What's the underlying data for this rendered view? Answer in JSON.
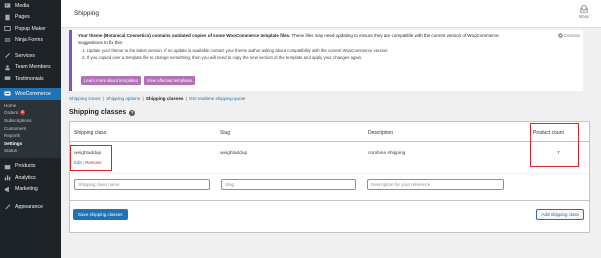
{
  "sidebar": {
    "items_top": [
      {
        "label": "Media",
        "icon": "media-icon"
      },
      {
        "label": "Pages",
        "icon": "pages-icon"
      },
      {
        "label": "Popup Maker",
        "icon": "popup-icon"
      },
      {
        "label": "Ninja Forms",
        "icon": "forms-icon"
      },
      {
        "label": "Services",
        "icon": "services-icon"
      },
      {
        "label": "Team Members",
        "icon": "team-icon"
      },
      {
        "label": "Testimonials",
        "icon": "testimonials-icon"
      }
    ],
    "active": {
      "label": "WooCommerce",
      "icon": "woocommerce-icon"
    },
    "submenu": [
      {
        "label": "Home"
      },
      {
        "label": "Orders",
        "badge": "3"
      },
      {
        "label": "Subscriptions"
      },
      {
        "label": "Customers"
      },
      {
        "label": "Reports"
      },
      {
        "label": "Settings"
      },
      {
        "label": "Status"
      }
    ],
    "items_bottom": [
      {
        "label": "Products",
        "icon": "products-icon"
      },
      {
        "label": "Analytics",
        "icon": "analytics-icon"
      },
      {
        "label": "Marketing",
        "icon": "marketing-icon"
      },
      {
        "label": "Appearance",
        "icon": "appearance-icon"
      }
    ]
  },
  "header": {
    "title": "Shipping",
    "inbox_label": "Inbox"
  },
  "notice": {
    "bold": "Your theme (Botanical Cosmetics) contains outdated copies of some WooCommerce template files.",
    "text": " These files may need updating to ensure they are compatible with the current version of WooCommerce. Suggestions to fix this:",
    "dismiss": "Dismiss",
    "steps": [
      "1. Update your theme to the latest version. If no update is available contact your theme author asking about compatibility with the current WooCommerce version.",
      "2. If you copied over a template file to change something, then you will need to copy the new version of the template and apply your changes again."
    ],
    "btn_learn": "Learn more about templates",
    "btn_view": "View affected templates"
  },
  "subnav": {
    "items": [
      "Shipping zones",
      "Shipping options",
      "Shipping classes",
      "ESI realtime shipping quote"
    ],
    "separator": "|"
  },
  "page": {
    "heading": "Shipping classes",
    "help": "?"
  },
  "table": {
    "headers": {
      "class": "Shipping class",
      "slug": "Slug",
      "description": "Description",
      "count": "Product count"
    },
    "rows": [
      {
        "class": "weightaddup",
        "slug": "weightaddup",
        "description": "combine shipping",
        "count": "7"
      }
    ],
    "row_actions": {
      "edit": "Edit",
      "remove": "Remove",
      "separator": "|"
    },
    "new_row": {
      "name_placeholder": "Shipping class name",
      "slug_placeholder": "Slug",
      "description_placeholder": "Description for your reference"
    },
    "save_label": "Save shipping classes",
    "add_label": "Add shipping class"
  },
  "colors": {
    "sidebar_bg": "#1d2327",
    "accent": "#2271b1",
    "notice_border": "#7f54b3",
    "notice_button": "#b172b7",
    "highlight": "#e1242a"
  }
}
